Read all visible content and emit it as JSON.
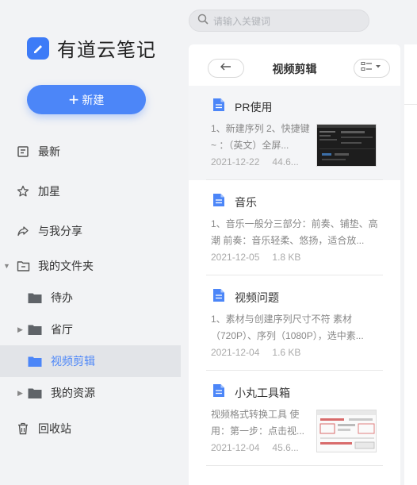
{
  "app": {
    "name": "有道云笔记",
    "brand_color": "#4c86f8"
  },
  "sidebar": {
    "new_label": "新建",
    "items": [
      {
        "label": "最新",
        "icon": "recent-icon"
      },
      {
        "label": "加星",
        "icon": "star-icon"
      },
      {
        "label": "与我分享",
        "icon": "share-icon"
      },
      {
        "label": "我的文件夹",
        "icon": "folder-outline-icon"
      },
      {
        "label": "待办",
        "icon": "folder-icon"
      },
      {
        "label": "省厅",
        "icon": "folder-icon"
      },
      {
        "label": "视频剪辑",
        "icon": "folder-icon",
        "active": true
      },
      {
        "label": "我的资源",
        "icon": "folder-icon"
      },
      {
        "label": "回收站",
        "icon": "trash-icon"
      }
    ]
  },
  "search": {
    "placeholder": "请输入关键词"
  },
  "panel": {
    "title": "视频剪辑"
  },
  "notes": [
    {
      "title": "PR使用",
      "snippet": "1、新建序列 2、快捷键 ~ ：（英文）全屏...",
      "date": "2021-12-22",
      "size": "44.6...",
      "has_thumb": true
    },
    {
      "title": "音乐",
      "snippet": "1、音乐一般分三部分：前奏、铺垫、高潮 前奏：音乐轻柔、悠扬，适合放...",
      "date": "2021-12-05",
      "size": "1.8 KB",
      "has_thumb": false
    },
    {
      "title": "视频问题",
      "snippet": "1、素材与创建序列尺寸不符 素材（720P）、序列（1080P），选中素...",
      "date": "2021-12-04",
      "size": "1.6 KB",
      "has_thumb": false
    },
    {
      "title": "小丸工具箱",
      "snippet": "视频格式转换工具 使用：第一步：点击视...",
      "date": "2021-12-04",
      "size": "45.6...",
      "has_thumb": true
    }
  ]
}
